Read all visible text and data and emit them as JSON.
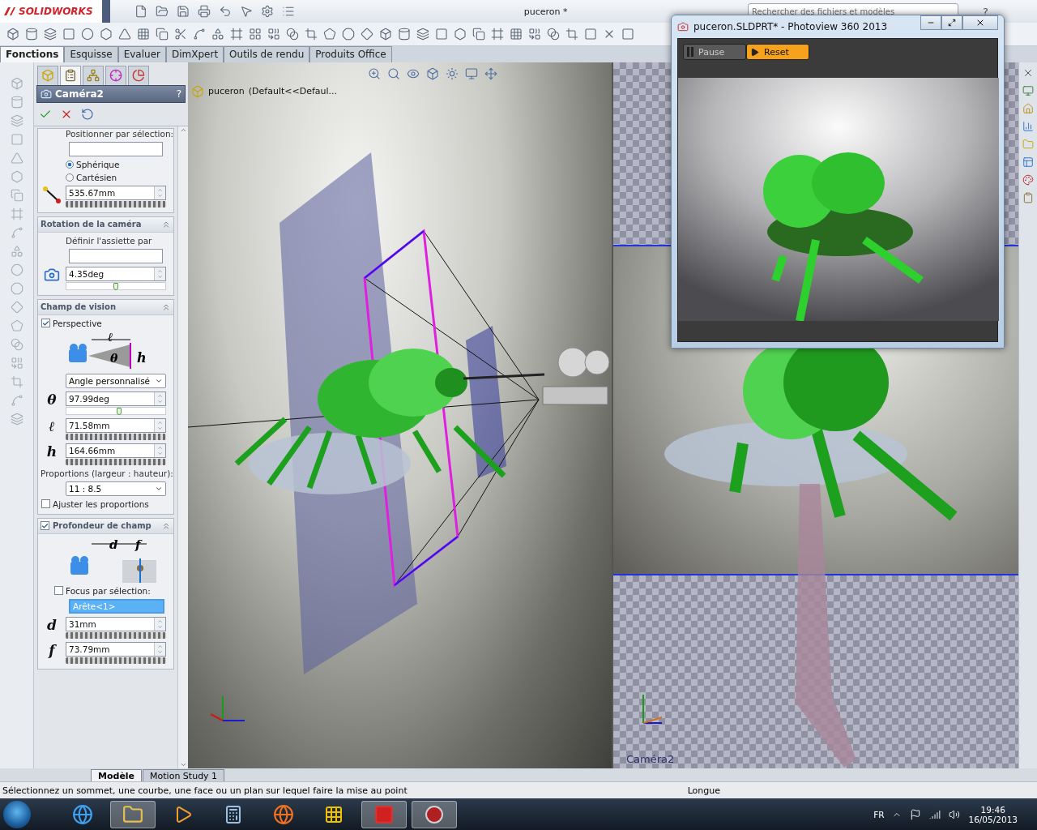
{
  "app": {
    "logo": "SOLIDWORKS",
    "title": "puceron *",
    "search": {
      "placeholder": "Rechercher des fichiers et modèles"
    },
    "help": "?"
  },
  "tabs": [
    {
      "label": "Fonctions",
      "selected": true
    },
    {
      "label": "Esquisse",
      "selected": false
    },
    {
      "label": "Evaluer",
      "selected": false
    },
    {
      "label": "DimXpert",
      "selected": false
    },
    {
      "label": "Outils de rendu",
      "selected": false
    },
    {
      "label": "Produits Office",
      "selected": false
    }
  ],
  "property_manager": {
    "title": "Caméra2",
    "help": "?",
    "position": {
      "label": "Positionner par sélection:",
      "radios": [
        {
          "label": "Sphérique",
          "selected": true
        },
        {
          "label": "Cartésien",
          "selected": false
        }
      ],
      "control": {
        "kind": "wheel",
        "value": "535.67mm"
      }
    },
    "rotation": {
      "title": "Rotation de la caméra",
      "label": "Définir l'assiette par",
      "control": {
        "kind": "slider",
        "value": "4.35deg",
        "level": 0.5
      }
    },
    "field_of_view": {
      "title": "Champ de vision",
      "perspective": {
        "label": "Perspective",
        "checked": true
      },
      "diagram_labels": [
        "ℓ",
        "θ",
        "h"
      ],
      "mode": "Angle personnalisé",
      "controls": [
        {
          "kind": "slider",
          "symbol": "θ",
          "value": "97.99deg",
          "level": 0.53
        },
        {
          "kind": "wheel",
          "symbol": "ℓ",
          "value": "71.58mm"
        },
        {
          "kind": "wheel",
          "symbol": "h",
          "value": "164.66mm"
        }
      ],
      "proportions_label": "Proportions (largeur : hauteur):",
      "proportions": "11 : 8.5",
      "adjust": {
        "label": "Ajuster les proportions",
        "checked": false
      }
    },
    "depth_of_field": {
      "title": "Profondeur de champ",
      "checked": true,
      "diagram_labels": [
        "d",
        "f"
      ],
      "focus": {
        "label": "Focus par sélection:",
        "checked": false
      },
      "selection": "Arête<1>",
      "controls": [
        {
          "kind": "wheel",
          "symbol": "d",
          "value": "31mm"
        },
        {
          "kind": "wheel",
          "symbol": "f",
          "value": "73.79mm"
        }
      ]
    }
  },
  "viewport": {
    "part": "puceron",
    "configuration": "(Default<<Defaul..."
  },
  "camera_view": {
    "label": "Caméra2"
  },
  "photoview": {
    "title": "puceron.SLDPRT* - Photoview 360 2013",
    "buttons": [
      {
        "label": "Pause",
        "selected": false
      },
      {
        "label": "Reset",
        "selected": true
      }
    ]
  },
  "bottom_tabs": [
    {
      "label": "Modèle",
      "selected": true
    },
    {
      "label": "Motion Study 1",
      "selected": false
    }
  ],
  "status_bar": {
    "message": "Sélectionnez un sommet, une courbe, une face ou un plan sur lequel faire la mise au point",
    "right": "Longue"
  },
  "taskbar": {
    "language": "FR",
    "time": "19:46",
    "date": "16/05/2013"
  }
}
